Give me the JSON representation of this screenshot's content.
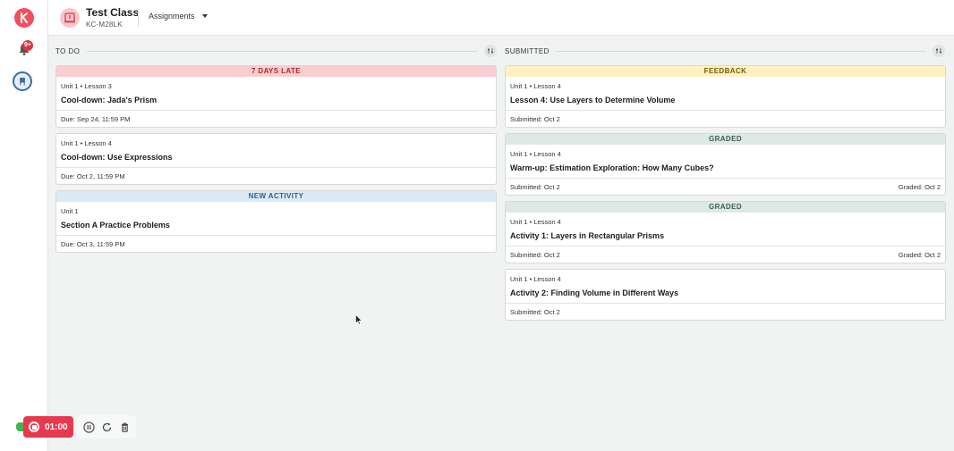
{
  "rail": {
    "notification_badge": "9+"
  },
  "header": {
    "class_title": "Test Class",
    "class_code": "KC-M28LK",
    "menu_label": "Assignments"
  },
  "todo": {
    "heading": "TO DO",
    "cards": [
      {
        "banner": "7 DAYS LATE",
        "unit": "Unit 1 • Lesson 3",
        "title": "Cool-down: Jada's Prism",
        "left": "Due: Sep 24, 11:59 PM",
        "right": ""
      },
      {
        "banner": "",
        "unit": "Unit 1 • Lesson 4",
        "title": "Cool-down: Use Expressions",
        "left": "Due: Oct 2, 11:59 PM",
        "right": ""
      },
      {
        "banner": "NEW ACTIVITY",
        "unit": "Unit 1",
        "title": "Section A Practice Problems",
        "left": "Due: Oct 3, 11:59 PM",
        "right": ""
      }
    ]
  },
  "submitted": {
    "heading": "SUBMITTED",
    "cards": [
      {
        "banner": "FEEDBACK",
        "unit": "Unit 1 • Lesson 4",
        "title": "Lesson 4: Use Layers to Determine Volume",
        "left": "Submitted: Oct 2",
        "right": ""
      },
      {
        "banner": "GRADED",
        "unit": "Unit 1 • Lesson 4",
        "title": "Warm-up: Estimation Exploration: How Many Cubes?",
        "left": "Submitted: Oct 2",
        "right": "Graded: Oct 2"
      },
      {
        "banner": "GRADED",
        "unit": "Unit 1 • Lesson 4",
        "title": "Activity 1: Layers in Rectangular Prisms",
        "left": "Submitted: Oct 2",
        "right": "Graded: Oct 2"
      },
      {
        "banner": "",
        "unit": "Unit 1 • Lesson 4",
        "title": "Activity 2: Finding Volume in Different Ways",
        "left": "Submitted: Oct 2",
        "right": ""
      }
    ]
  },
  "recorder": {
    "time": "01:00"
  },
  "colors": {
    "brand": "#ef4f5e",
    "late": "#f9cfd1",
    "new": "#dce9f6",
    "feedback": "#fff1c2",
    "graded": "#dde9e6",
    "record": "#e63950"
  }
}
